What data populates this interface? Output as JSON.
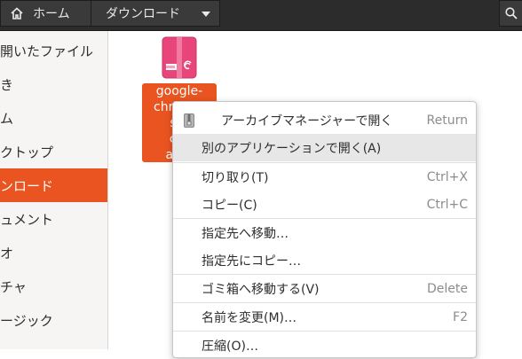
{
  "header": {
    "home_label": "ホーム",
    "location_label": "ダウンロード"
  },
  "sidebar": {
    "items": [
      {
        "label": "開いたファイル"
      },
      {
        "label": "き"
      },
      {
        "label": "ム"
      },
      {
        "label": "クトップ"
      },
      {
        "label": "ンロード"
      },
      {
        "label": "ュメント"
      },
      {
        "label": "オ"
      },
      {
        "label": "チャ"
      },
      {
        "label": "ージック"
      }
    ]
  },
  "file": {
    "name_lines": [
      "google-",
      "chrome-",
      "sta",
      "cur",
      "amd"
    ]
  },
  "context_menu": {
    "items": [
      {
        "label": "アーカイブマネージャーで開く",
        "accel": "Return"
      },
      {
        "label": "別のアプリケーションで開く(A)",
        "accel": ""
      },
      {
        "label": "切り取り(T)",
        "accel": "Ctrl+X"
      },
      {
        "label": "コピー(C)",
        "accel": "Ctrl+C"
      },
      {
        "label": "指定先へ移動…",
        "accel": ""
      },
      {
        "label": "指定先にコピー…",
        "accel": ""
      },
      {
        "label": "ゴミ箱へ移動する(V)",
        "accel": "Delete"
      },
      {
        "label": "名前を変更(M)…",
        "accel": "F2"
      },
      {
        "label": "圧縮(O)…",
        "accel": ""
      }
    ]
  },
  "colors": {
    "accent": "#e95420",
    "header_bg": "#2c2c2c",
    "file_icon_pink": "#e8457a"
  }
}
